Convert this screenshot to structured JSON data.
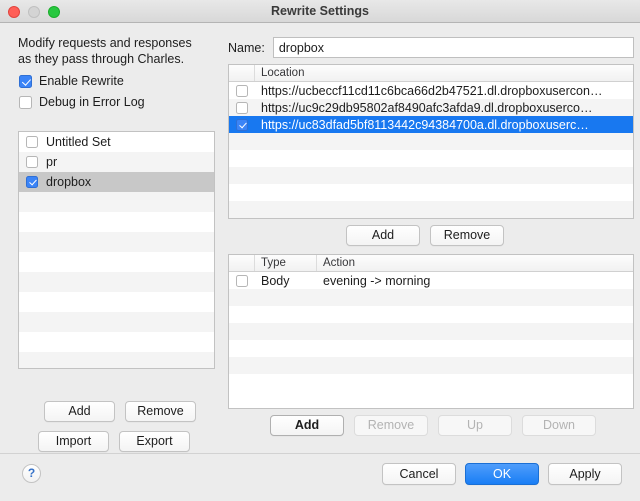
{
  "window": {
    "title": "Rewrite Settings",
    "traffic_lights": [
      "close-button",
      "minimize-button",
      "zoom-button"
    ],
    "accent_color": "#1878f0",
    "selection_color": "#1878f0",
    "checkbox_color": "#3b84f7"
  },
  "left": {
    "description_line1": "Modify requests and responses",
    "description_line2": "as they pass through Charles.",
    "enable_rewrite": {
      "label": "Enable Rewrite",
      "checked": true
    },
    "debug_in_error_log": {
      "label": "Debug in Error Log",
      "checked": false
    },
    "sets": [
      {
        "label": "Untitled Set",
        "checked": false,
        "selected": false
      },
      {
        "label": "pr",
        "checked": false,
        "selected": false
      },
      {
        "label": "dropbox",
        "checked": true,
        "selected": true
      }
    ],
    "buttons": {
      "add": "Add",
      "remove": "Remove",
      "import": "Import",
      "export": "Export"
    }
  },
  "right": {
    "name_label": "Name:",
    "name_value": "dropbox",
    "name_placeholder": "",
    "locations_table": {
      "columns": [
        "",
        "Location"
      ],
      "rows": [
        {
          "checked": false,
          "selected": false,
          "location": "https://ucbeccf11cd11c6bca66d2b47521.dl.dropboxusercon…"
        },
        {
          "checked": false,
          "selected": false,
          "location": "https://uc9c29db95802af8490afc3afda9.dl.dropboxuserco…"
        },
        {
          "checked": true,
          "selected": true,
          "location": "https://uc83dfad5bf8113442c94384700a.dl.dropboxuserc…"
        }
      ]
    },
    "locations_buttons": {
      "add": "Add",
      "remove": "Remove"
    },
    "actions_table": {
      "columns": [
        "",
        "Type",
        "Action"
      ],
      "rows": [
        {
          "checked": false,
          "type": "Body",
          "action": "evening -> morning"
        }
      ]
    },
    "actions_buttons": {
      "add": {
        "label": "Add",
        "enabled": true
      },
      "remove": {
        "label": "Remove",
        "enabled": false
      },
      "up": {
        "label": "Up",
        "enabled": false
      },
      "down": {
        "label": "Down",
        "enabled": false
      }
    }
  },
  "footer": {
    "help": "?",
    "cancel": "Cancel",
    "ok": "OK",
    "apply": "Apply"
  }
}
